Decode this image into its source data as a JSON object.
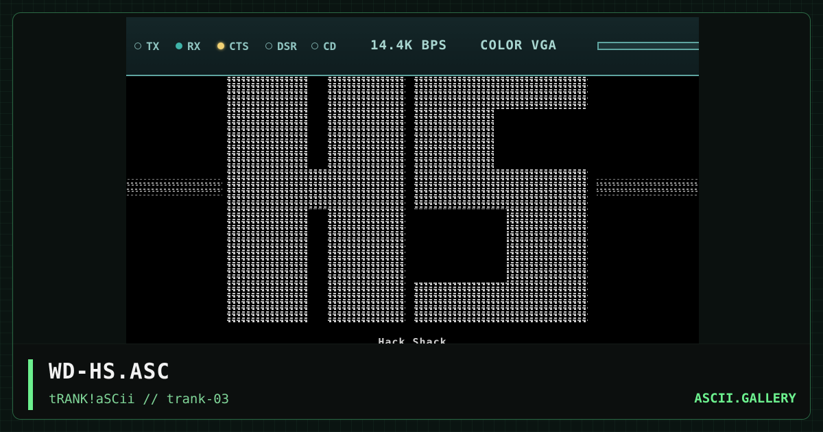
{
  "status_bar": {
    "indicators": [
      {
        "label": "TX",
        "state": "off"
      },
      {
        "label": "RX",
        "state": "on"
      },
      {
        "label": "CTS",
        "state": "on"
      },
      {
        "label": "DSR",
        "state": "off"
      },
      {
        "label": "CD",
        "state": "off"
      }
    ],
    "speed": "14.4K BPS",
    "mode": "COLOR VGA"
  },
  "artwork": {
    "text": "HS",
    "caption": "Hack Shack"
  },
  "file": {
    "name": "WD-HS.ASC",
    "meta": "tRANK!aSCii // trank-03"
  },
  "brand": "ASCII.GALLERY",
  "colors": {
    "accent": "#6cf08e",
    "led_rx": "#3fb3a8",
    "led_cts": "#f2d274",
    "status_text": "#8fc4c0"
  }
}
